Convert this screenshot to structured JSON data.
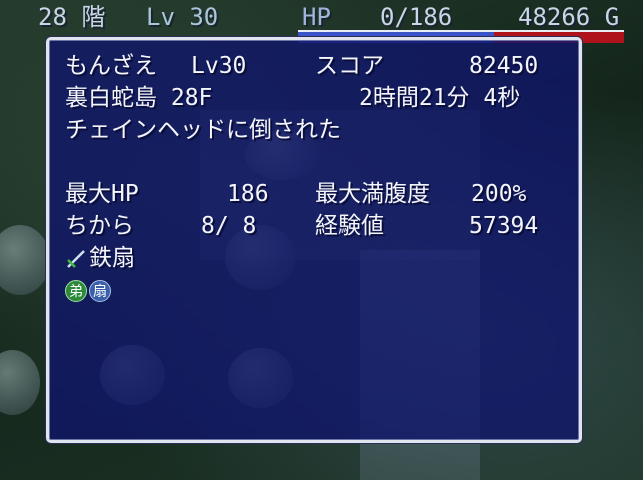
{
  "hud": {
    "floor": "28 階",
    "level": "Lv 30",
    "hp_label": "HP",
    "hp_value": "0/186",
    "gold": "48266 G",
    "hp_fraction": 0.6
  },
  "result": {
    "name": "もんざえ",
    "level": "Lv30",
    "score_label": "スコア",
    "score": "82450",
    "dungeon": "裏白蛇島 28F",
    "time": "2時間21分 4秒",
    "cause": "チェインヘッドに倒された",
    "maxhp_label": "最大HP",
    "maxhp": "186",
    "fullness_label": "最大満腹度",
    "fullness": "200%",
    "strength_label": "ちから",
    "strength": "8/ 8",
    "exp_label": "経験値",
    "exp": "57394",
    "weapon": "鉄扇",
    "seal_badge": "弟",
    "seal_item": "扇"
  },
  "colors": {
    "window_bg": "#10146c",
    "hp_bar_red": "#b0121b",
    "hp_bar_blue": "#3a52c8"
  }
}
